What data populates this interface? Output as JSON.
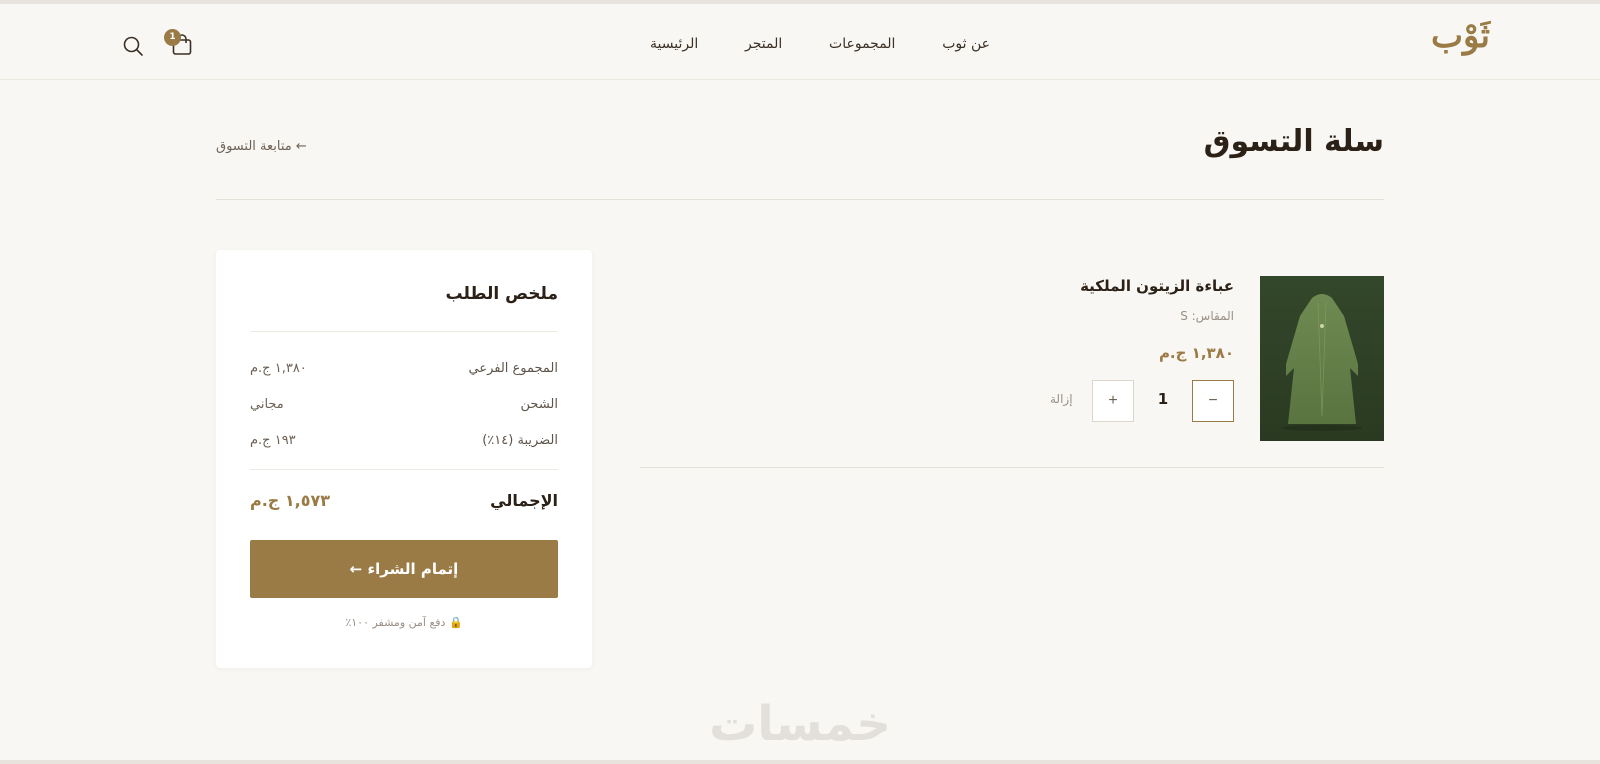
{
  "header": {
    "logo": "ثَوْب",
    "nav": [
      "الرئيسية",
      "المتجر",
      "المجموعات",
      "عن ثوب"
    ],
    "cart_count": "1"
  },
  "page": {
    "title": "سلة التسوق",
    "continue_shopping": "← متابعة التسوق"
  },
  "cart_item": {
    "name": "عباءة الزيتون الملكية",
    "size": "المقاس: S",
    "price": "١,٣٨٠ ج.م",
    "quantity": "1",
    "minus": "−",
    "plus": "+",
    "remove": "إزالة",
    "image_color": "#4a5a34"
  },
  "summary": {
    "title": "ملخص الطلب",
    "rows": [
      {
        "label": "المجموع الفرعي",
        "value": "١,٣٨٠ ج.م"
      },
      {
        "label": "الشحن",
        "value": "مجاني"
      },
      {
        "label": "الضريبة (١٤٪)",
        "value": "١٩٣ ج.م"
      }
    ],
    "total_label": "الإجمالي",
    "total_value": "١,٥٧٣ ج.م",
    "checkout": "إتمام الشراء ←",
    "secure_note": "🔒 دفع آمن ومشفر ١٠٠٪"
  },
  "colors": {
    "accent": "#9a7a45",
    "background": "#f9f7f3"
  },
  "watermark": "خمسات"
}
